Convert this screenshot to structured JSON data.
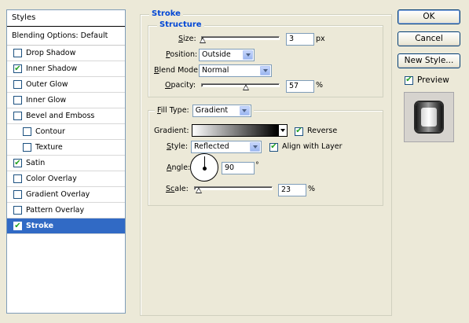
{
  "styles_panel": {
    "header": "Styles",
    "blending_options": "Blending Options: Default",
    "items": [
      {
        "label": "Drop Shadow",
        "checked": false
      },
      {
        "label": "Inner Shadow",
        "checked": true
      },
      {
        "label": "Outer Glow",
        "checked": false
      },
      {
        "label": "Inner Glow",
        "checked": false
      },
      {
        "label": "Bevel and Emboss",
        "checked": false
      },
      {
        "label": "Contour",
        "checked": false
      },
      {
        "label": "Texture",
        "checked": false
      },
      {
        "label": "Satin",
        "checked": true
      },
      {
        "label": "Color Overlay",
        "checked": false
      },
      {
        "label": "Gradient Overlay",
        "checked": false
      },
      {
        "label": "Pattern Overlay",
        "checked": false
      },
      {
        "label": "Stroke",
        "checked": true
      }
    ]
  },
  "stroke": {
    "legend": "Stroke",
    "structure": {
      "legend": "Structure",
      "size_label": "Size:",
      "size_value": "3",
      "size_unit": "px",
      "position_label": "Position:",
      "position_value": "Outside",
      "blend_mode_label": "Blend Mode:",
      "blend_mode_value": "Normal",
      "opacity_label": "Opacity:",
      "opacity_value": "57",
      "opacity_unit": "%"
    },
    "fill": {
      "fill_type_label": "Fill Type:",
      "fill_type_value": "Gradient",
      "gradient_label": "Gradient:",
      "reverse_label": "Reverse",
      "reverse_checked": true,
      "style_label": "Style:",
      "style_value": "Reflected",
      "align_label": "Align with Layer",
      "align_checked": true,
      "angle_label": "Angle:",
      "angle_value": "90",
      "angle_unit": "°",
      "scale_label": "Scale:",
      "scale_value": "23",
      "scale_unit": "%"
    }
  },
  "buttons": {
    "ok": "OK",
    "cancel": "Cancel",
    "new_style": "New Style...",
    "preview_label": "Preview",
    "preview_checked": true
  },
  "colors": {
    "selection": "#316ac5",
    "legend_text": "#0046d5",
    "check_mark": "#21a121"
  }
}
